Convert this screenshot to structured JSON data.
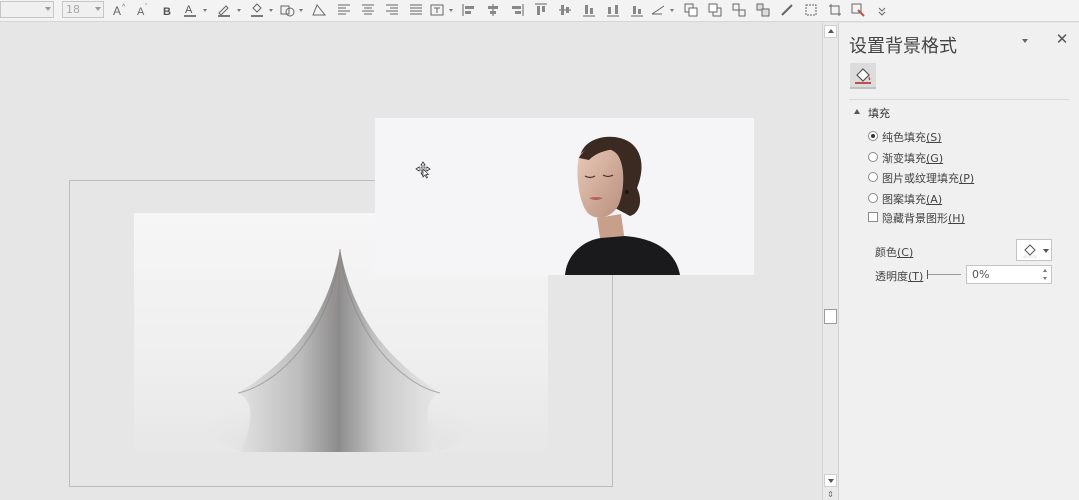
{
  "ribbon": {
    "font_name_value": "",
    "font_size_value": "18",
    "tools": [
      "increase-font-size-icon",
      "decrease-font-size-icon",
      "bold-icon",
      "font-color-icon",
      "highlight-icon",
      "shape-fill-icon",
      "shape-outline-icon",
      "edit-shape-icon",
      "align-left-icon",
      "align-center-icon",
      "align-right-icon",
      "justify-icon",
      "text-box-icon",
      "align-objects-left-icon",
      "align-objects-center-icon",
      "align-objects-right-icon",
      "align-objects-top-icon",
      "align-objects-middle-icon",
      "align-objects-bottom-icon",
      "rotate-icon",
      "bring-forward-icon",
      "send-backward-icon",
      "group-icon",
      "ungroup-icon",
      "format-painter-icon",
      "select-all-icon",
      "crop-icon",
      "pick-color-icon",
      "more-icon"
    ]
  },
  "pane": {
    "title": "设置背景格式",
    "fill_tab_icon": "paint-bucket-icon",
    "section_label": "填充",
    "options": [
      {
        "label": "纯色填充",
        "key": "(S)",
        "type": "radio",
        "selected": true
      },
      {
        "label": "渐变填充",
        "key": "(G)",
        "type": "radio",
        "selected": false
      },
      {
        "label": "图片或纹理填充",
        "key": "(P)",
        "type": "radio",
        "selected": false
      },
      {
        "label": "图案填充",
        "key": "(A)",
        "type": "radio",
        "selected": false
      },
      {
        "label": "隐藏背景图形",
        "key": "(H)",
        "type": "checkbox",
        "selected": false
      }
    ],
    "color_label": "颜色",
    "color_key": "(C)",
    "transparency_label": "透明度",
    "transparency_key": "(T)",
    "transparency_value": "0%",
    "transparency_fraction": 0.0
  },
  "colors": {
    "ribbon_bg": "#f3f3f3",
    "canvas_bg": "#e6e6e6",
    "pane_bg": "#f0f0f0",
    "accent": "#c0504d"
  }
}
